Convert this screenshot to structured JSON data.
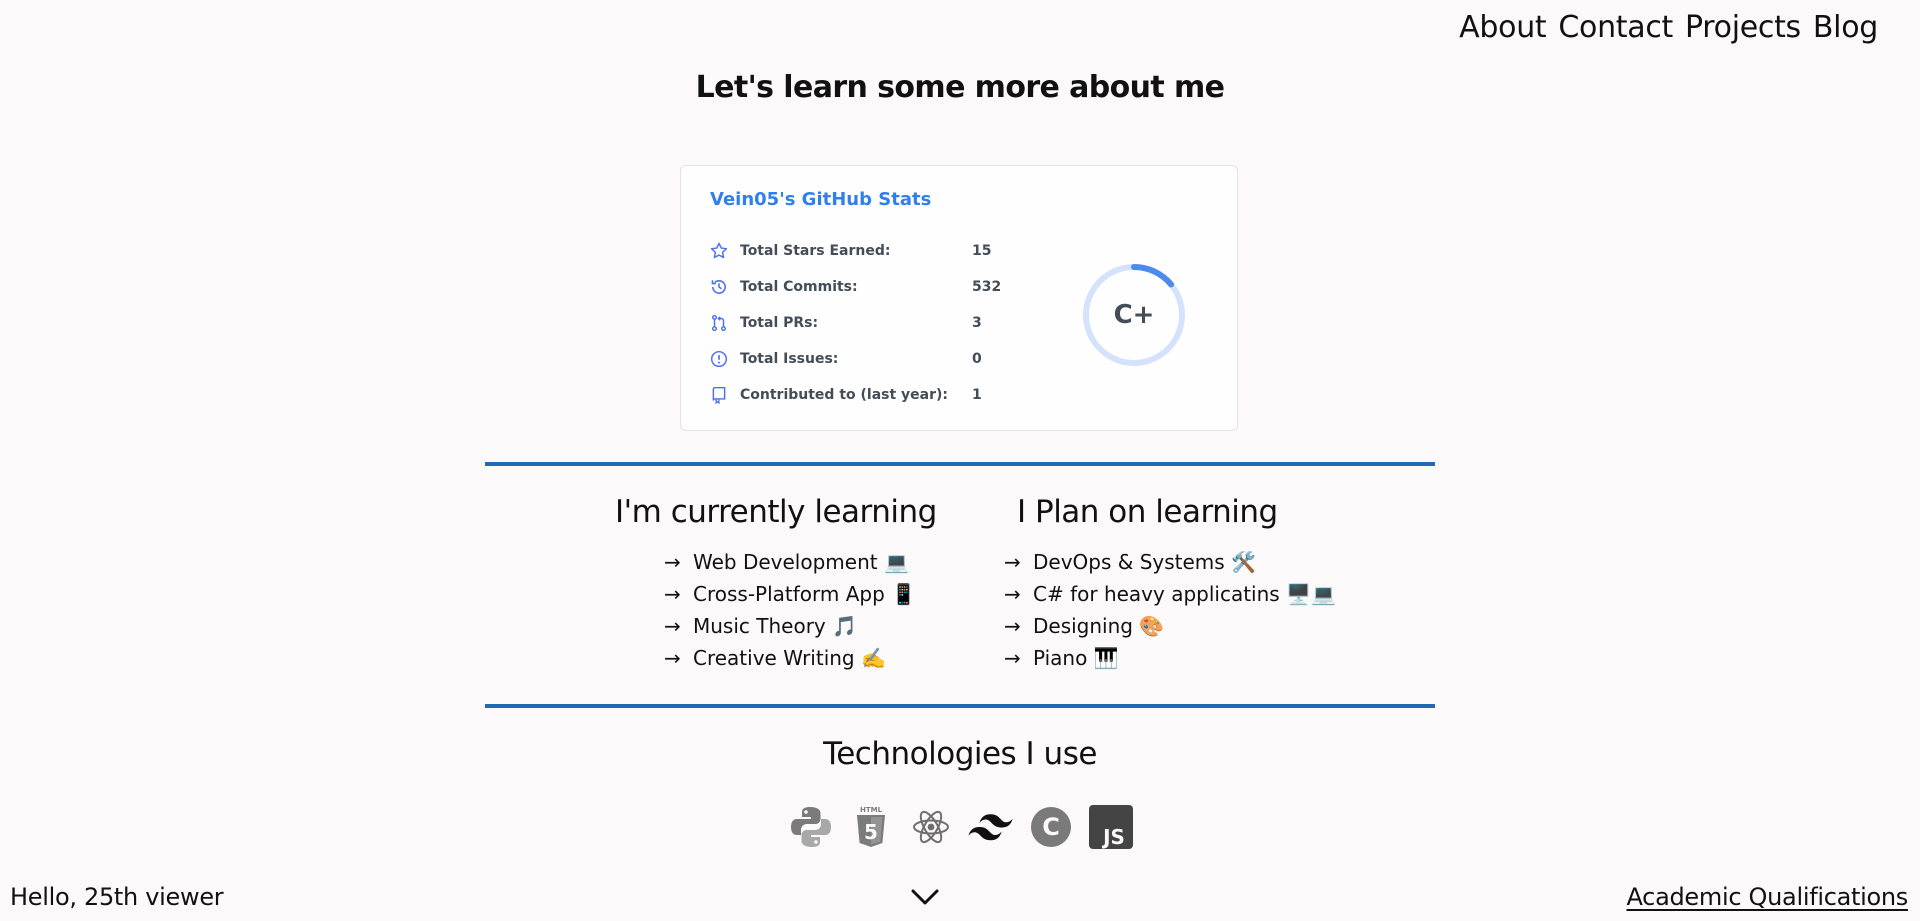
{
  "nav": {
    "items": [
      {
        "label": "About"
      },
      {
        "label": "Contact"
      },
      {
        "label": "Projects"
      },
      {
        "label": "Blog"
      }
    ]
  },
  "heading": "Let's learn some more about me",
  "stats_card": {
    "title": "Vein05's GitHub Stats",
    "accent_color": "#2f80ed",
    "rows": [
      {
        "icon": "star-icon",
        "label": "Total Stars Earned:",
        "value": "15"
      },
      {
        "icon": "history-icon",
        "label": "Total Commits:",
        "value": "532"
      },
      {
        "icon": "pull-request-icon",
        "label": "Total PRs:",
        "value": "3"
      },
      {
        "icon": "issue-icon",
        "label": "Total Issues:",
        "value": "0"
      },
      {
        "icon": "repo-icon",
        "label": "Contributed to (last year):",
        "value": "1"
      }
    ],
    "rank": "C+",
    "rank_progress_fraction": 0.14
  },
  "learning": {
    "current_title": "I'm currently learning",
    "current_items": [
      {
        "text": "Web Development 💻"
      },
      {
        "text": "Cross-Platform App 📱"
      },
      {
        "text": "Music Theory 🎵"
      },
      {
        "text": "Creative Writing ✍️"
      }
    ],
    "plan_title": "I Plan on learning",
    "plan_items": [
      {
        "text": "DevOps & Systems 🛠️"
      },
      {
        "text": "C# for heavy applicatins 🖥️💻"
      },
      {
        "text": "Designing 🎨"
      },
      {
        "text": "Piano 🎹"
      }
    ],
    "arrow": "→",
    "divider_color": "#1f6ab5"
  },
  "technologies": {
    "title": "Technologies I use",
    "icons": [
      "python-icon",
      "html5-icon",
      "react-icon",
      "tailwind-icon",
      "c-icon",
      "javascript-icon"
    ],
    "html_badge_text": "HTML",
    "html_badge_number": "5",
    "c_text": "C",
    "js_text": "JS"
  },
  "footer": {
    "viewer_text": "Hello, 25th viewer",
    "link": "Academic Qualifications",
    "chevron_icon": "chevron-down-icon"
  }
}
